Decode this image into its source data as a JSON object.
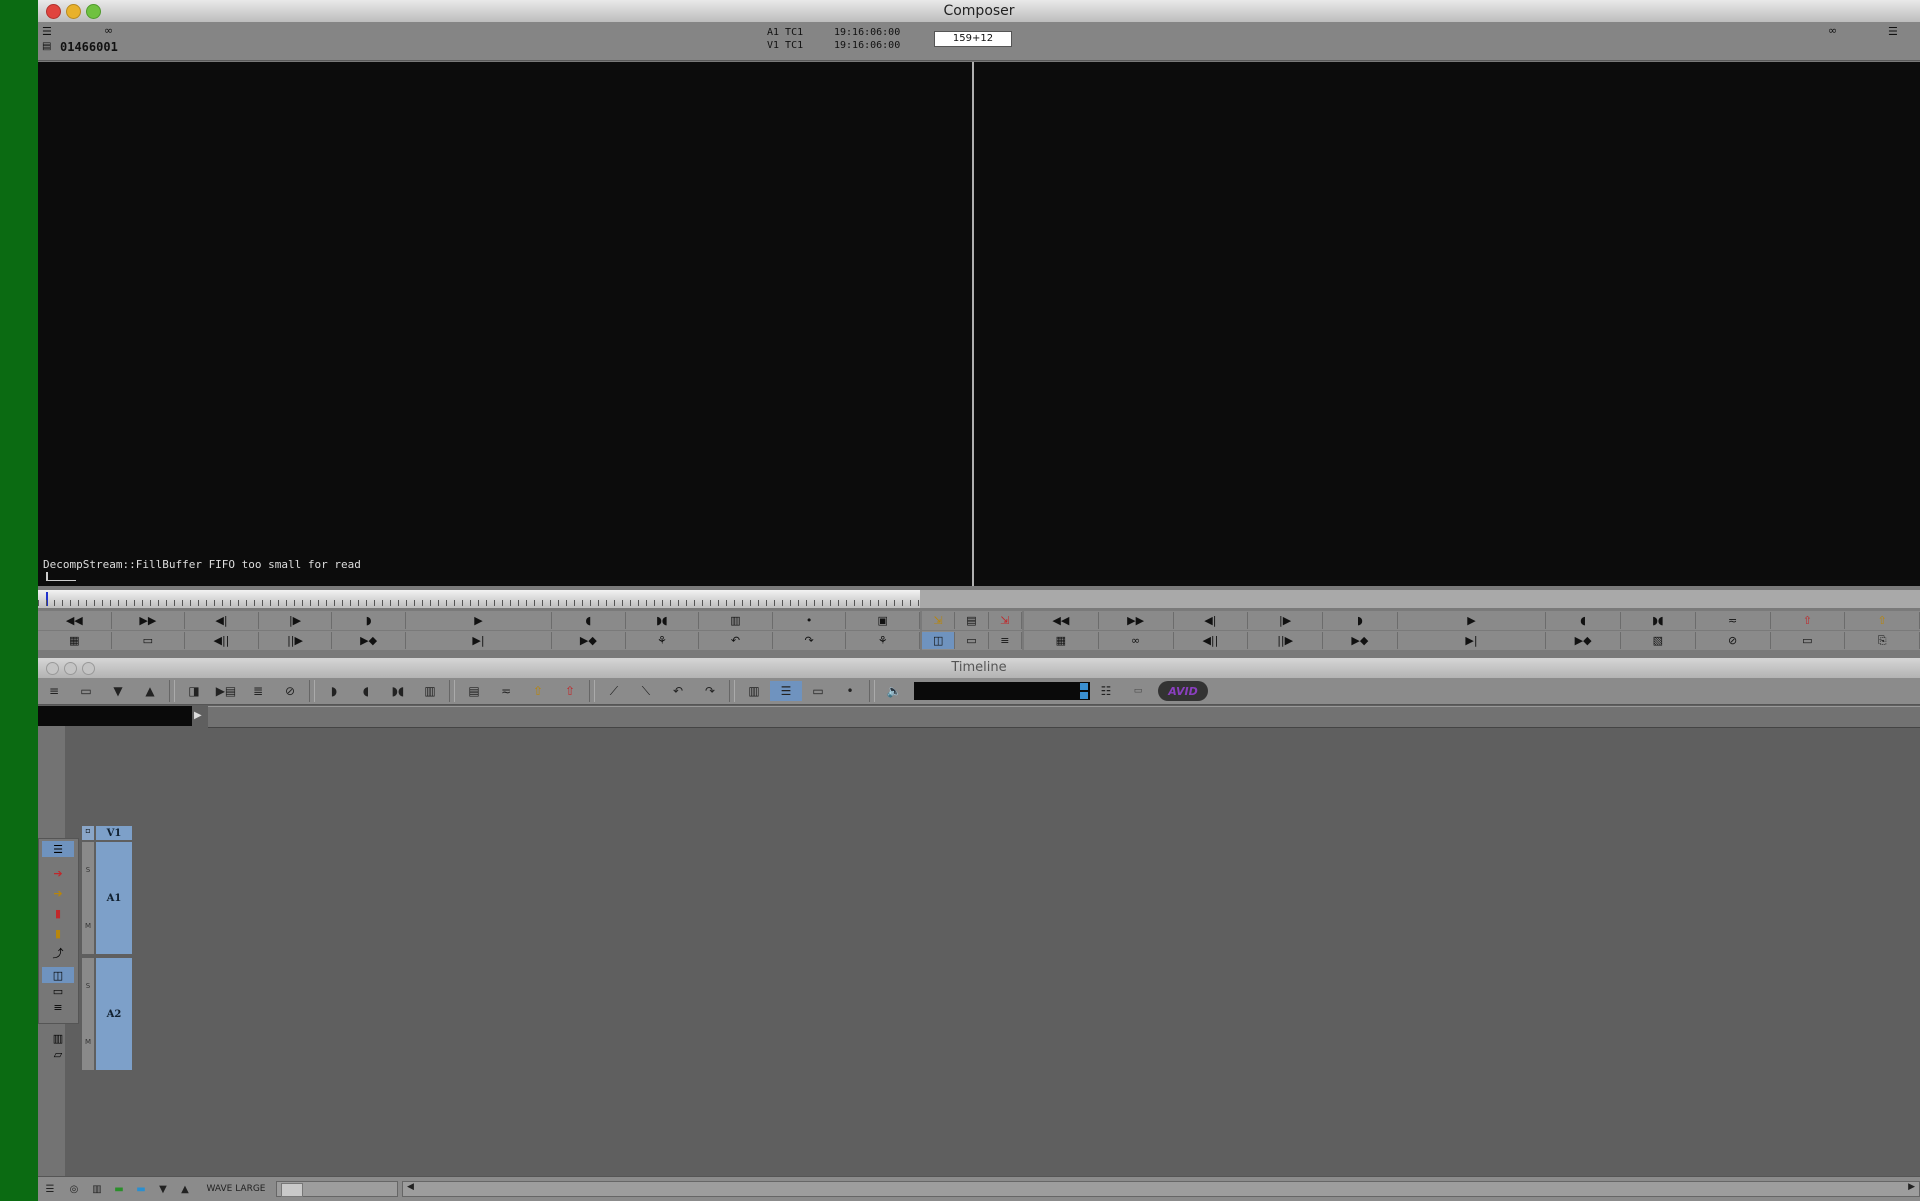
{
  "composer": {
    "title": "Composer",
    "clip_name": "01466001",
    "tc_rows": [
      {
        "label": "A1 TC1",
        "value": "19:16:06:00"
      },
      {
        "label": "V1 TC1",
        "value": "19:16:06:00"
      }
    ],
    "position_field": "159+12",
    "status_message": "DecompStream::FillBuffer FIFO too small for read"
  },
  "timeline": {
    "title": "Timeline",
    "tracks": {
      "v1": "V1",
      "a1": "A1",
      "a2": "A2",
      "solo_label": "S",
      "mute_label": "M"
    },
    "brand": "AVID",
    "bottom_bar": {
      "view_label": "WAVE LARGE"
    }
  },
  "colors": {
    "desktop": "#0b6b12",
    "track_blue": "#7da0c9",
    "avid_purple": "#8a3fbf"
  }
}
